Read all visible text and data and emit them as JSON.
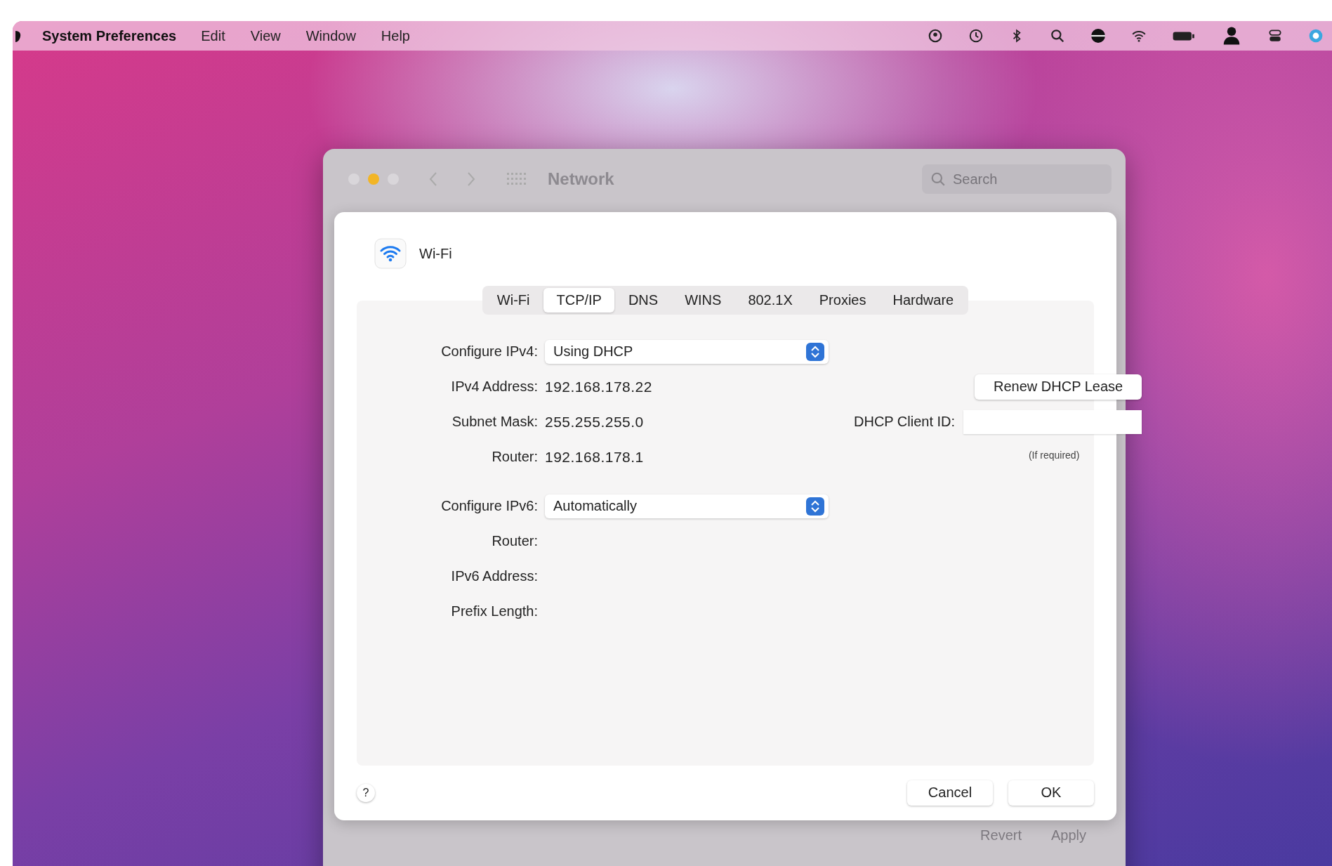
{
  "menu_bar": {
    "app_name": "System Preferences",
    "menus": [
      "Edit",
      "View",
      "Window",
      "Help"
    ]
  },
  "window": {
    "title": "Network",
    "search": {
      "placeholder": "Search"
    },
    "buttons": [
      {
        "label": "Revert",
        "disabled": true
      },
      {
        "label": "Apply",
        "disabled": true
      }
    ]
  },
  "sheet": {
    "service": "Wi-Fi",
    "tabs": [
      {
        "label": "Wi-Fi",
        "selected": false
      },
      {
        "label": "TCP/IP",
        "selected": true
      },
      {
        "label": "DNS",
        "selected": false
      },
      {
        "label": "WINS",
        "selected": false
      },
      {
        "label": "802.1X",
        "selected": false
      },
      {
        "label": "Proxies",
        "selected": false
      },
      {
        "label": "Hardware",
        "selected": false
      }
    ],
    "ipv4_rows": [
      {
        "kind": "popup",
        "label": "Configure IPv4:",
        "value": "Using DHCP"
      },
      {
        "kind": "value",
        "label": "IPv4 Address:",
        "value": "192.168.178.22",
        "right": {
          "kind": "button",
          "label": "Renew DHCP Lease"
        }
      },
      {
        "kind": "value",
        "label": "Subnet Mask:",
        "value": "255.255.255.0",
        "right": {
          "kind": "field",
          "label": "DHCP Client ID:"
        }
      },
      {
        "kind": "value",
        "label": "Router:",
        "value": "192.168.178.1",
        "right": {
          "kind": "hint",
          "text": "(If required)"
        }
      }
    ],
    "ipv6_rows": [
      {
        "kind": "popup",
        "label": "Configure IPv6:",
        "value": "Automatically"
      },
      {
        "kind": "value",
        "label": "Router:"
      },
      {
        "kind": "value",
        "label": "IPv6 Address:"
      },
      {
        "kind": "value",
        "label": "Prefix Length:"
      }
    ],
    "help": "?",
    "buttons": [
      {
        "label": "Cancel"
      },
      {
        "label": "OK"
      }
    ]
  }
}
